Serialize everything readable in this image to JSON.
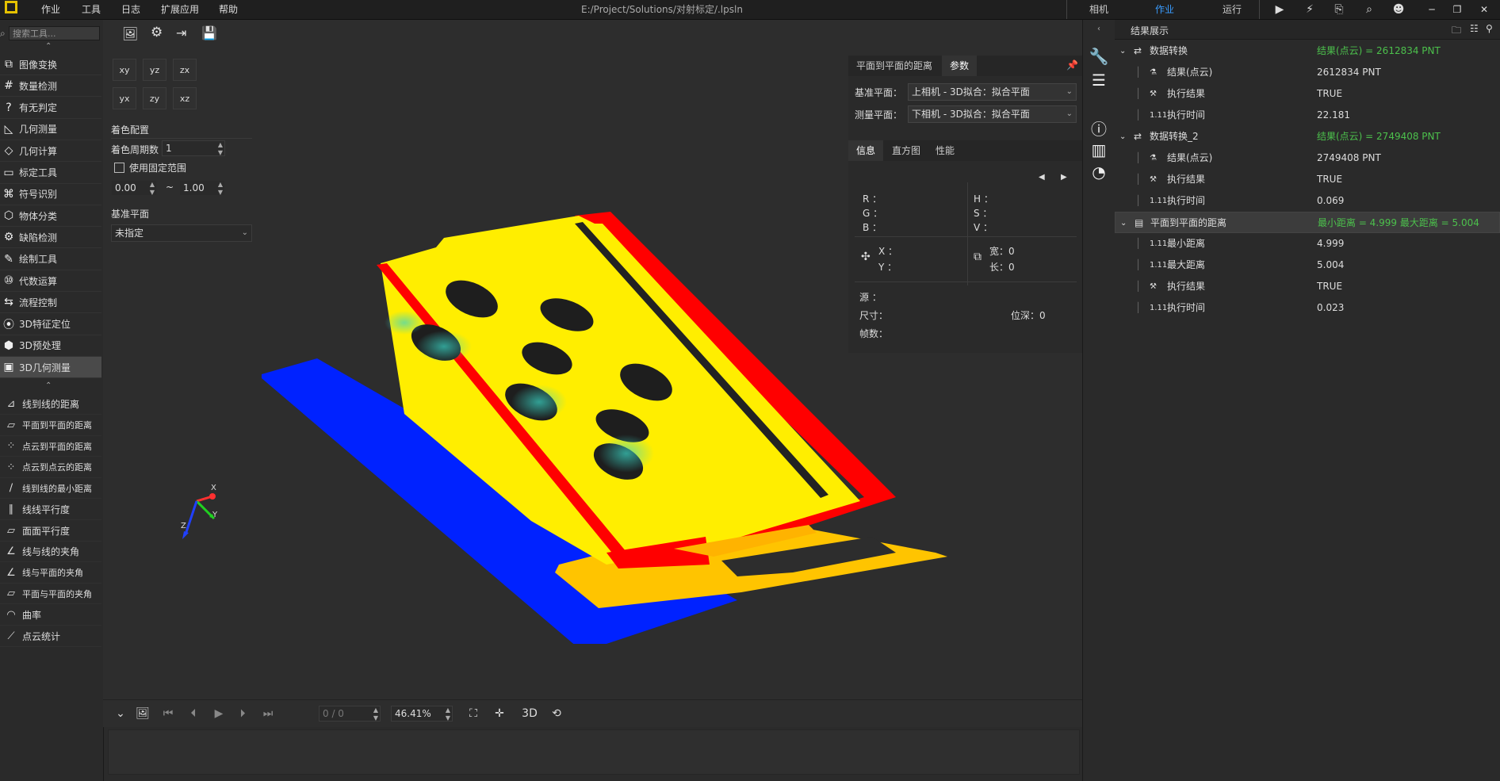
{
  "menubar": {
    "items": [
      "作业",
      "工具",
      "日志",
      "扩展应用",
      "帮助"
    ],
    "title": "E:/Project/Solutions/对射标定/.lpsln",
    "tabs": [
      "相机",
      "作业",
      "运行"
    ],
    "active_tab": "作业"
  },
  "left": {
    "search_placeholder": "搜索工具...",
    "categories": [
      "图像变换",
      "数量检测",
      "有无判定",
      "几何测量",
      "几何计算",
      "标定工具",
      "符号识别",
      "物体分类",
      "缺陷检测",
      "绘制工具",
      "代数运算",
      "流程控制",
      "3D特征定位",
      "3D预处理",
      "3D几何测量"
    ],
    "active_category": "3D几何测量",
    "tools": [
      "线到线的距离",
      "平面到平面的距离",
      "点云到平面的距离",
      "点云到点云的距离",
      "线到线的最小距离",
      "线线平行度",
      "面面平行度",
      "线与线的夹角",
      "线与平面的夹角",
      "平面与平面的夹角",
      "曲率",
      "点云统计"
    ]
  },
  "viewport": {
    "view_buttons_row1": [
      "xy",
      "yz",
      "zx"
    ],
    "view_buttons_row2": [
      "yx",
      "zy",
      "xz"
    ],
    "color_config_label": "着色配置",
    "color_period_label": "着色周期数",
    "color_period_value": "1",
    "fixed_range_label": "使用固定范围",
    "range_min": "0.00",
    "range_sep": "~",
    "range_max": "1.00",
    "base_plane_label": "基准平面",
    "base_plane_value": "未指定",
    "axis_x": "X",
    "axis_y": "Y",
    "axis_z": "Z"
  },
  "params": {
    "tabs": [
      "平面到平面的距离",
      "参数"
    ],
    "active_tab": "参数",
    "base_plane_label": "基准平面：",
    "base_plane_value": "上相机 - 3D拟合：拟合平面",
    "measure_plane_label": "测量平面：",
    "measure_plane_value": "下相机 - 3D拟合：拟合平面",
    "info_tabs": [
      "信息",
      "直方图",
      "性能"
    ],
    "r": "R ：",
    "g": "G ：",
    "b": "B ：",
    "h": "H ：",
    "s": "S ：",
    "v": "V ：",
    "x": "X ：",
    "y": "Y ：",
    "width": "宽：0",
    "length": "长：0",
    "source": "源    ：",
    "size": "尺寸：",
    "depth": "位深：0",
    "frames": "帧数："
  },
  "results": {
    "title": "结果展示",
    "rows": [
      {
        "name": "数据转换",
        "value": "结果(点云) = 2612834 PNT",
        "level": 0,
        "green": true
      },
      {
        "name": "结果(点云)",
        "value": "2612834 PNT",
        "level": 1
      },
      {
        "name": "执行结果",
        "value": "TRUE",
        "level": 1
      },
      {
        "name": "执行时间",
        "value": "22.181",
        "level": 1
      },
      {
        "name": "数据转换_2",
        "value": "结果(点云) = 2749408 PNT",
        "level": 0,
        "green": true
      },
      {
        "name": "结果(点云)",
        "value": "2749408 PNT",
        "level": 1
      },
      {
        "name": "执行结果",
        "value": "TRUE",
        "level": 1
      },
      {
        "name": "执行时间",
        "value": "0.069",
        "level": 1
      },
      {
        "name": "平面到平面的距离",
        "value": "最小距离 = 4.999 最大距离 = 5.004",
        "level": 0,
        "green": true,
        "selected": true
      },
      {
        "name": "最小距离",
        "value": "4.999",
        "level": 1
      },
      {
        "name": "最大距离",
        "value": "5.004",
        "level": 1
      },
      {
        "name": "执行结果",
        "value": "TRUE",
        "level": 1
      },
      {
        "name": "执行时间",
        "value": "0.023",
        "level": 1
      }
    ]
  },
  "bottom": {
    "frame": "0 / 0",
    "zoom": "46.41%",
    "mode3d": "3D"
  },
  "colors": {
    "yellow": "#ffee00",
    "red": "#ff0000",
    "blue": "#0022ff",
    "orange": "#ffb300",
    "green_text": "#4cc04c"
  }
}
